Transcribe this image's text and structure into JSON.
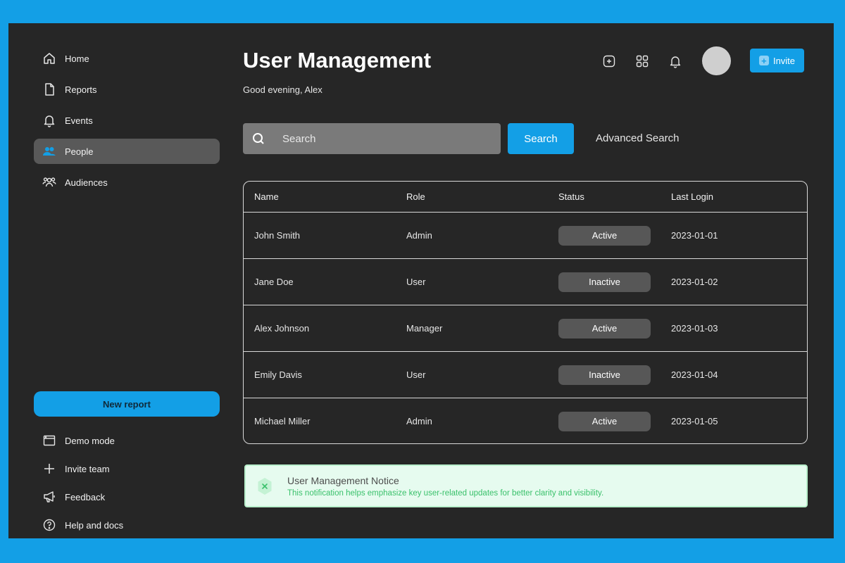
{
  "sidebar": {
    "nav": [
      {
        "label": "Home",
        "icon": "home-icon"
      },
      {
        "label": "Reports",
        "icon": "document-icon"
      },
      {
        "label": "Events",
        "icon": "bell-icon"
      },
      {
        "label": "People",
        "icon": "people-icon",
        "active": true
      },
      {
        "label": "Audiences",
        "icon": "audiences-icon"
      }
    ],
    "new_report_label": "New report",
    "bottom": [
      {
        "label": "Demo mode",
        "icon": "window-icon"
      },
      {
        "label": "Invite team",
        "icon": "plus-icon"
      },
      {
        "label": "Feedback",
        "icon": "megaphone-icon"
      },
      {
        "label": "Help and docs",
        "icon": "help-icon"
      }
    ]
  },
  "header": {
    "title": "User Management",
    "subtitle": "Good evening, Alex",
    "invite_label": "Invite",
    "icons": [
      "add-square-icon",
      "grid-icon",
      "bell-icon",
      "avatar"
    ]
  },
  "search": {
    "placeholder": "Search",
    "button_label": "Search",
    "advanced_label": "Advanced Search"
  },
  "table": {
    "columns": [
      "Name",
      "Role",
      "Status",
      "Last Login"
    ],
    "rows": [
      {
        "name": "John Smith",
        "role": "Admin",
        "status": "Active",
        "last_login": "2023-01-01"
      },
      {
        "name": "Jane Doe",
        "role": "User",
        "status": "Inactive",
        "last_login": "2023-01-02"
      },
      {
        "name": "Alex Johnson",
        "role": "Manager",
        "status": "Active",
        "last_login": "2023-01-03"
      },
      {
        "name": "Emily Davis",
        "role": "User",
        "status": "Inactive",
        "last_login": "2023-01-04"
      },
      {
        "name": "Michael Miller",
        "role": "Admin",
        "status": "Active",
        "last_login": "2023-01-05"
      }
    ]
  },
  "notice": {
    "title": "User Management Notice",
    "text": "This notification helps emphasize key user-related updates for better clarity and visibility."
  },
  "colors": {
    "accent": "#139fe6",
    "background": "#262626",
    "notice_bg": "#e6fbef",
    "notice_text": "#3ac16b"
  }
}
